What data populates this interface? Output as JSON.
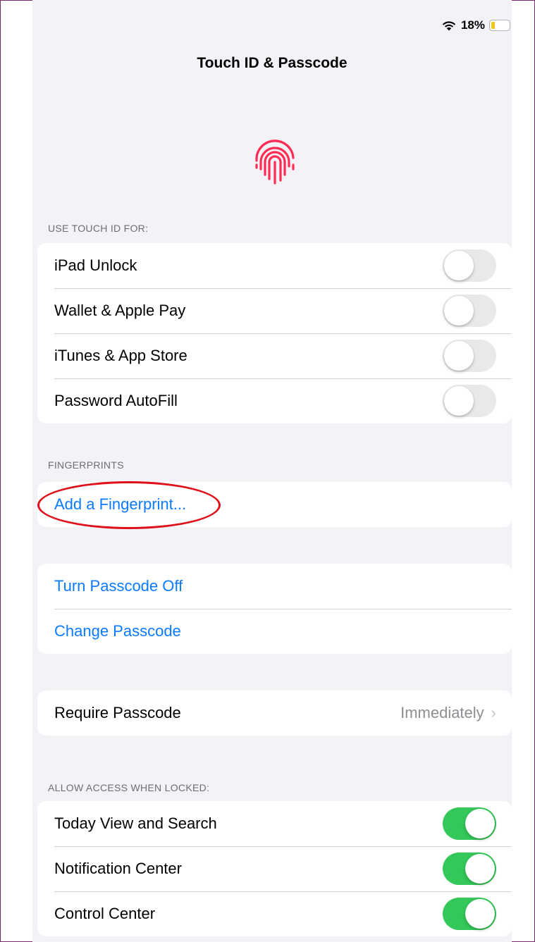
{
  "status_bar": {
    "wifi_icon": "wifi-icon",
    "battery_percent": "18%",
    "battery_level": 0.18,
    "battery_color": "#f5c518"
  },
  "title": "Touch ID & Passcode",
  "hero_icon": "fingerprint-icon",
  "hero_color": "#ff2d55",
  "use_touch_id": {
    "header": "USE TOUCH ID FOR:",
    "items": [
      {
        "label": "iPad Unlock",
        "on": false
      },
      {
        "label": "Wallet & Apple Pay",
        "on": false
      },
      {
        "label": "iTunes & App Store",
        "on": false
      },
      {
        "label": "Password AutoFill",
        "on": false
      }
    ]
  },
  "fingerprints": {
    "header": "FINGERPRINTS",
    "add_label": "Add a Fingerprint..."
  },
  "passcode": {
    "turn_off_label": "Turn Passcode Off",
    "change_label": "Change Passcode"
  },
  "require_passcode": {
    "label": "Require Passcode",
    "value": "Immediately",
    "chevron": "›"
  },
  "allow_access": {
    "header": "ALLOW ACCESS WHEN LOCKED:",
    "items": [
      {
        "label": "Today View and Search",
        "on": true
      },
      {
        "label": "Notification Center",
        "on": true
      },
      {
        "label": "Control Center",
        "on": true
      }
    ]
  },
  "colors": {
    "link": "#0a7aff",
    "toggle_on": "#34c759",
    "annotation": "#e0101b"
  }
}
